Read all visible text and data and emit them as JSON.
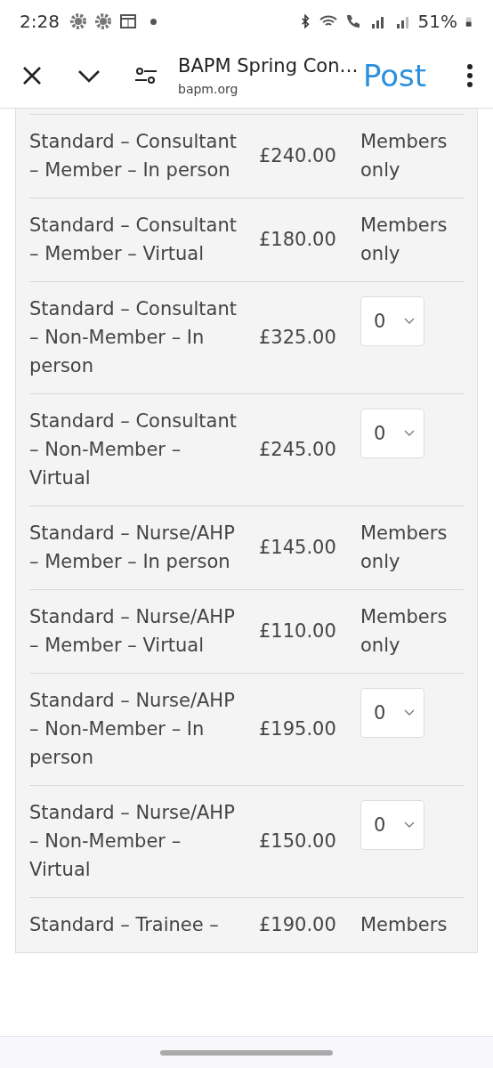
{
  "status_bar": {
    "time": "2:28",
    "battery": "51%"
  },
  "toolbar": {
    "title": "BAPM Spring Con…",
    "url": "bapm.org",
    "action": "Post"
  },
  "tickets": [
    {
      "name": "Standard – Consultant – Member – In person",
      "price": "£240.00",
      "kind": "note",
      "note": "Members only"
    },
    {
      "name": "Standard – Consultant – Member – Virtual",
      "price": "£180.00",
      "kind": "note",
      "note": "Members only"
    },
    {
      "name": "Standard – Consultant – Non-Member – In person",
      "price": "£325.00",
      "kind": "select",
      "value": "0"
    },
    {
      "name": "Standard – Consultant – Non-Member – Virtual",
      "price": "£245.00",
      "kind": "select",
      "value": "0"
    },
    {
      "name": "Standard – Nurse/AHP – Member – In person",
      "price": "£145.00",
      "kind": "note",
      "note": "Members only"
    },
    {
      "name": "Standard – Nurse/AHP – Member – Virtual",
      "price": "£110.00",
      "kind": "note",
      "note": "Members only"
    },
    {
      "name": "Standard – Nurse/AHP – Non-Member – In person",
      "price": "£195.00",
      "kind": "select",
      "value": "0"
    },
    {
      "name": "Standard – Nurse/AHP – Non-Member – Virtual",
      "price": "£150.00",
      "kind": "select",
      "value": "0"
    },
    {
      "name": "Standard – Trainee –",
      "price": "£190.00",
      "kind": "note",
      "note": "Members"
    }
  ]
}
